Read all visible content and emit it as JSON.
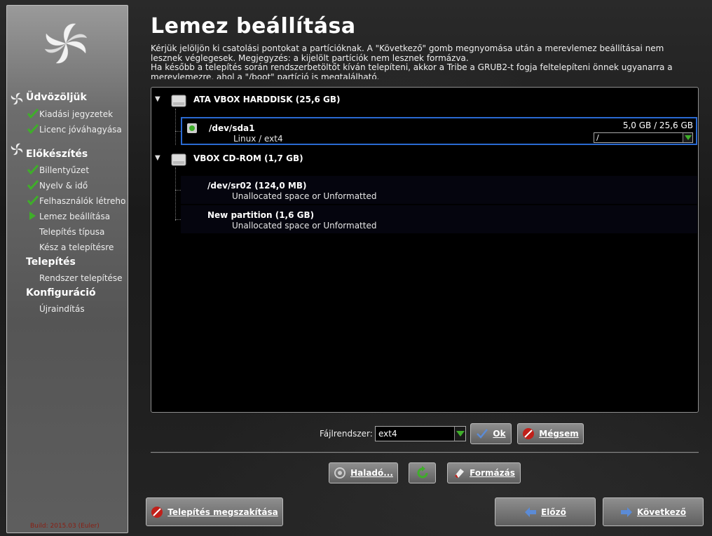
{
  "header": {
    "title": "Lemez beállítása",
    "intro_line1": "Kérjük jelöljön ki csatolási pontokat a partícióknak. A \"Következő\" gomb megnyomása után a merevlemez beállításai nem",
    "intro_line2": "lesznek véglegesek. Megjegyzés: a kijelölt partíciók nem lesznek formázva.",
    "intro_line3": "Ha később a telepítés során rendszerbetöltőt kíván telepíteni, akkor a Tribe a GRUB2-t fogja feltelepíteni önnek ugyanarra a",
    "intro_line4": "merevlemezre, ahol a \"/boot\" partíció is megtalálható."
  },
  "sidebar": {
    "groups": [
      {
        "title": "Üdvözöljük",
        "items": [
          {
            "label": "Kiadási jegyzetek",
            "state": "done"
          },
          {
            "label": "Licenc jóváhagyása",
            "state": "done"
          }
        ]
      },
      {
        "title": "Előkészítés",
        "items": [
          {
            "label": "Billentyűzet",
            "state": "done"
          },
          {
            "label": "Nyelv & idő",
            "state": "done"
          },
          {
            "label": "Felhasználók létrehozása",
            "state": "done"
          },
          {
            "label": "Lemez beállítása",
            "state": "current"
          },
          {
            "label": "Telepítés típusa",
            "state": "pending"
          },
          {
            "label": "Kész a telepítésre",
            "state": "pending"
          }
        ]
      },
      {
        "title": "Telepítés",
        "items": [
          {
            "label": "Rendszer telepítése",
            "state": "pending"
          }
        ]
      },
      {
        "title": "Konfiguráció",
        "items": [
          {
            "label": "Újraindítás",
            "state": "pending"
          }
        ]
      }
    ],
    "build": "Build: 2015.03 (Euler)"
  },
  "disks": [
    {
      "name": "ATA VBOX HARDDISK  (25,6 GB)",
      "partitions": [
        {
          "name": "/dev/sda1",
          "desc": "Linux / ext4",
          "size": "5,0 GB / 25,6 GB",
          "mount": "/",
          "selected": true
        }
      ]
    },
    {
      "name": "VBOX CD-ROM  (1,7 GB)",
      "partitions": [
        {
          "name": "/dev/sr02  (124,0 MB)",
          "desc": "Unallocated space or Unformatted"
        },
        {
          "name": "New partition  (1,6 GB)",
          "desc": "Unallocated space or Unformatted"
        }
      ]
    }
  ],
  "filesystem": {
    "label": "Fájlrendszer:",
    "value": "ext4"
  },
  "buttons": {
    "ok": "Ok",
    "cancel": "Mégsem",
    "advanced": "Haladó...",
    "format": "Formázás",
    "abort": "Telepítés megszakítása",
    "prev": "Előző",
    "next": "Következő"
  },
  "colors": {
    "accent_selection": "#2a6ad2",
    "check_green": "#3fae2a",
    "build_text": "#8a1e12"
  }
}
